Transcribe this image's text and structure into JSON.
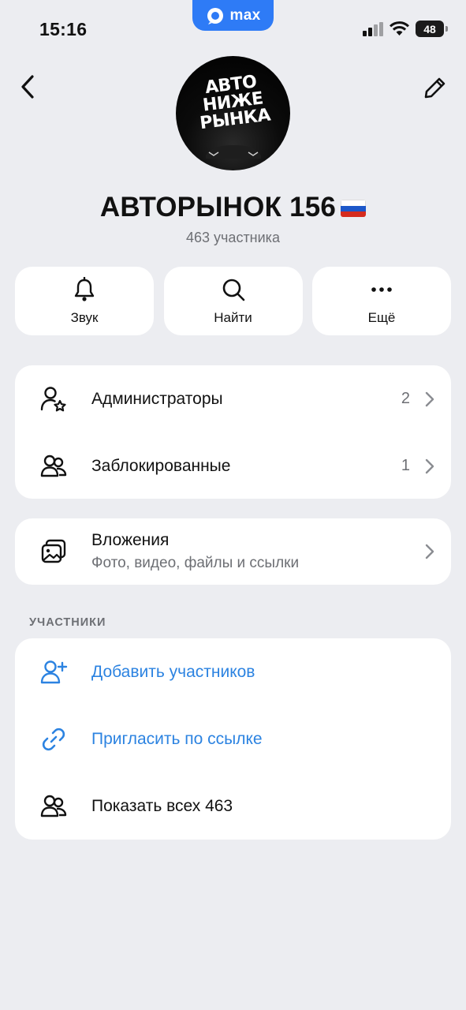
{
  "status_bar": {
    "time": "15:16",
    "app_pill_label": "max",
    "battery": "48",
    "signal_icon": "cellular-signal-icon",
    "wifi_icon": "wifi-icon"
  },
  "header": {
    "back_icon": "chevron-left-icon",
    "edit_icon": "pencil-icon",
    "avatar_text": [
      "АВТО",
      "НИЖЕ",
      "РЫНКА"
    ],
    "title": "АВТОРЫНОК 156",
    "subtitle": "463 участника"
  },
  "actions": [
    {
      "icon": "bell-icon",
      "label": "Звук"
    },
    {
      "icon": "search-icon",
      "label": "Найти"
    },
    {
      "icon": "more-icon",
      "label": "Ещё"
    }
  ],
  "management": [
    {
      "icon": "admin-icon",
      "label": "Администраторы",
      "count": "2"
    },
    {
      "icon": "blocked-users-icon",
      "label": "Заблокированные",
      "count": "1"
    }
  ],
  "attachments": {
    "icon": "gallery-icon",
    "label": "Вложения",
    "sub": "Фото, видео, файлы и ссылки"
  },
  "members_section": {
    "title": "УЧАСТНИКИ",
    "items": [
      {
        "icon": "add-user-icon",
        "label": "Добавить участников"
      },
      {
        "icon": "link-icon",
        "label": "Пригласить по ссылке"
      },
      {
        "icon": "users-icon",
        "label": "Показать всех 463"
      }
    ]
  },
  "colors": {
    "background": "#ecedf1",
    "accent": "#2c83e1",
    "pill": "#2e7bf6",
    "flag": [
      "#ffffff",
      "#1c57c9",
      "#d52b1e"
    ]
  }
}
